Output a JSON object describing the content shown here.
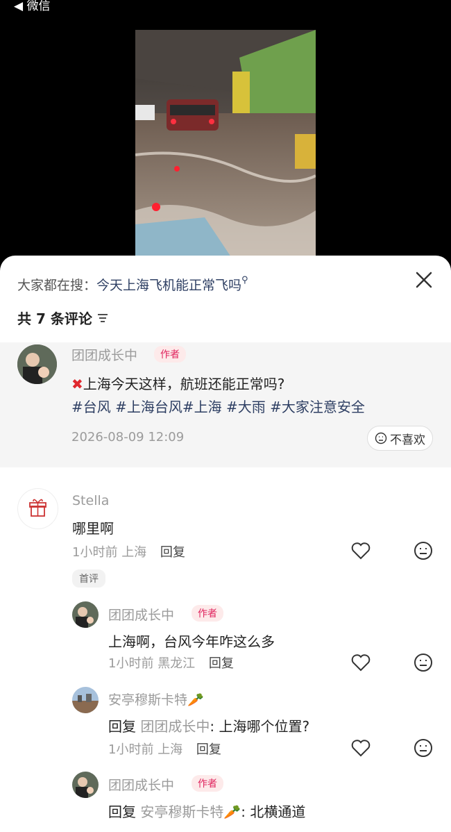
{
  "status_bar": {
    "back_label": "◀ 微信"
  },
  "search": {
    "prefix": "大家都在搜：",
    "keyword": "今天上海飞机能正常飞吗"
  },
  "comments_header": {
    "count_label": "共 7 条评论"
  },
  "post": {
    "author": "团团成长中",
    "author_badge": "作者",
    "text_line1": "上海今天这样，航班还能正常吗?",
    "text_line2": "#台风 #上海台风#上海 #大雨 #大家注意安全",
    "time": "2026-08-09 12:09",
    "dislike_label": "不喜欢"
  },
  "comments": [
    {
      "user": "Stella",
      "text": "哪里啊",
      "time": "1小时前",
      "location": "上海",
      "reply_label": "回复",
      "tag": "首评"
    }
  ],
  "replies": [
    {
      "user": "团团成长中",
      "badge": "作者",
      "text": "上海啊，台风今年咋这么多",
      "time": "1小时前",
      "location": "黑龙江",
      "reply_label": "回复"
    },
    {
      "user": "安亭穆斯卡特",
      "reply_prefix": "回复",
      "reply_to": "团团成长中",
      "text": ": 上海哪个位置?",
      "time": "1小时前",
      "location": "上海",
      "reply_label": "回复"
    },
    {
      "user": "团团成长中",
      "badge": "作者",
      "reply_prefix": "回复",
      "reply_to": "安亭穆斯卡特",
      "text": ": 北横通道"
    }
  ]
}
